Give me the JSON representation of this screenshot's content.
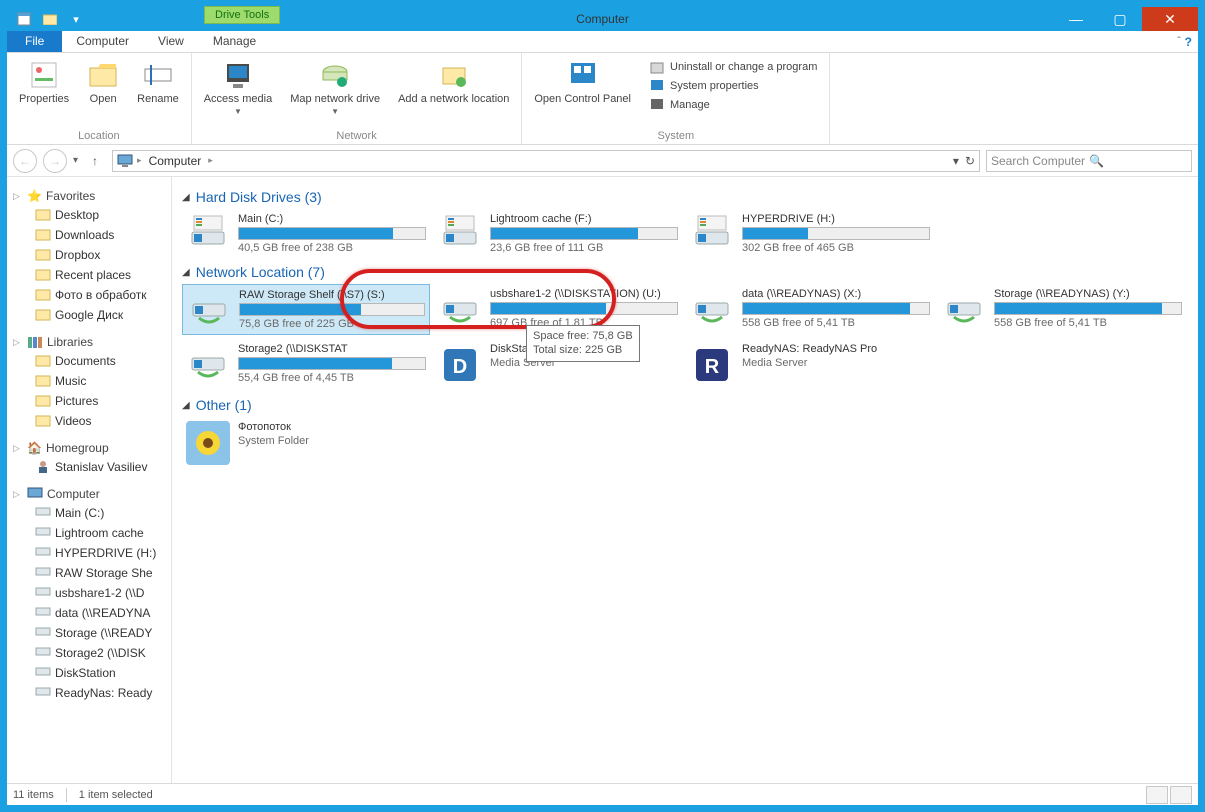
{
  "window": {
    "title": "Computer",
    "context_tab": "Drive Tools"
  },
  "tabs": {
    "file": "File",
    "computer": "Computer",
    "view": "View",
    "manage": "Manage"
  },
  "ribbon": {
    "location": {
      "title": "Location",
      "properties": "Properties",
      "open": "Open",
      "rename": "Rename"
    },
    "network": {
      "title": "Network",
      "access_media": "Access media",
      "map_drive": "Map network drive",
      "add_location": "Add a network location"
    },
    "open_cp": {
      "label": "Open Control Panel"
    },
    "system": {
      "title": "System",
      "uninstall": "Uninstall or change a program",
      "properties": "System properties",
      "manage": "Manage"
    }
  },
  "nav": {
    "crumb1": "Computer",
    "search_placeholder": "Search Computer"
  },
  "sidebar": {
    "favorites": "Favorites",
    "fav_items": [
      "Desktop",
      "Downloads",
      "Dropbox",
      "Recent places",
      "Фото в обработк",
      "Google Диск"
    ],
    "libraries": "Libraries",
    "lib_items": [
      "Documents",
      "Music",
      "Pictures",
      "Videos"
    ],
    "homegroup": "Homegroup",
    "hg_items": [
      "Stanislav Vasiliev"
    ],
    "computer": "Computer",
    "comp_items": [
      "Main (C:)",
      "Lightroom cache",
      "HYPERDRIVE (H:)",
      "RAW Storage She",
      "usbshare1-2 (\\\\D",
      "data (\\\\READYNA",
      "Storage (\\\\READY",
      "Storage2 (\\\\DISK",
      "DiskStation",
      "ReadyNas: Ready"
    ]
  },
  "sections": {
    "hdd": "Hard Disk Drives (3)",
    "netloc": "Network Location (7)",
    "other": "Other (1)"
  },
  "drives": {
    "hdd": [
      {
        "name": "Main (C:)",
        "stat": "40,5 GB free of 238 GB",
        "pct": 83
      },
      {
        "name": "Lightroom cache (F:)",
        "stat": "23,6 GB free of 111 GB",
        "pct": 79
      },
      {
        "name": "HYPERDRIVE (H:)",
        "stat": "302 GB free of 465 GB",
        "pct": 35
      }
    ],
    "net": [
      {
        "name": "RAW Storage Shelf (\\\\S7) (S:)",
        "stat": "75,8 GB free of 225 GB",
        "pct": 66,
        "selected": true
      },
      {
        "name": "usbshare1-2 (\\\\DISKSTATION) (U:)",
        "stat": "697 GB free of 1,81 TB",
        "pct": 62
      },
      {
        "name": "data (\\\\READYNAS) (X:)",
        "stat": "558 GB free of 5,41 TB",
        "pct": 90
      },
      {
        "name": "Storage (\\\\READYNAS) (Y:)",
        "stat": "558 GB free of 5,41 TB",
        "pct": 90
      },
      {
        "name": "Storage2 (\\\\DISKSTAT",
        "stat": "55,4 GB free of 4,45 TB",
        "pct": 82
      }
    ],
    "media": [
      {
        "name": "DiskStation",
        "sub": "Media Server",
        "color": "#3176b6"
      },
      {
        "name": "ReadyNAS: ReadyNAS Pro",
        "sub": "Media Server",
        "color": "#2a3a7c"
      }
    ],
    "other": [
      {
        "name": "Фотопоток",
        "sub": "System Folder"
      }
    ]
  },
  "tooltip": {
    "line1": "Space free: 75,8 GB",
    "line2": "Total size: 225 GB"
  },
  "status": {
    "items": "11 items",
    "selected": "1 item selected"
  }
}
